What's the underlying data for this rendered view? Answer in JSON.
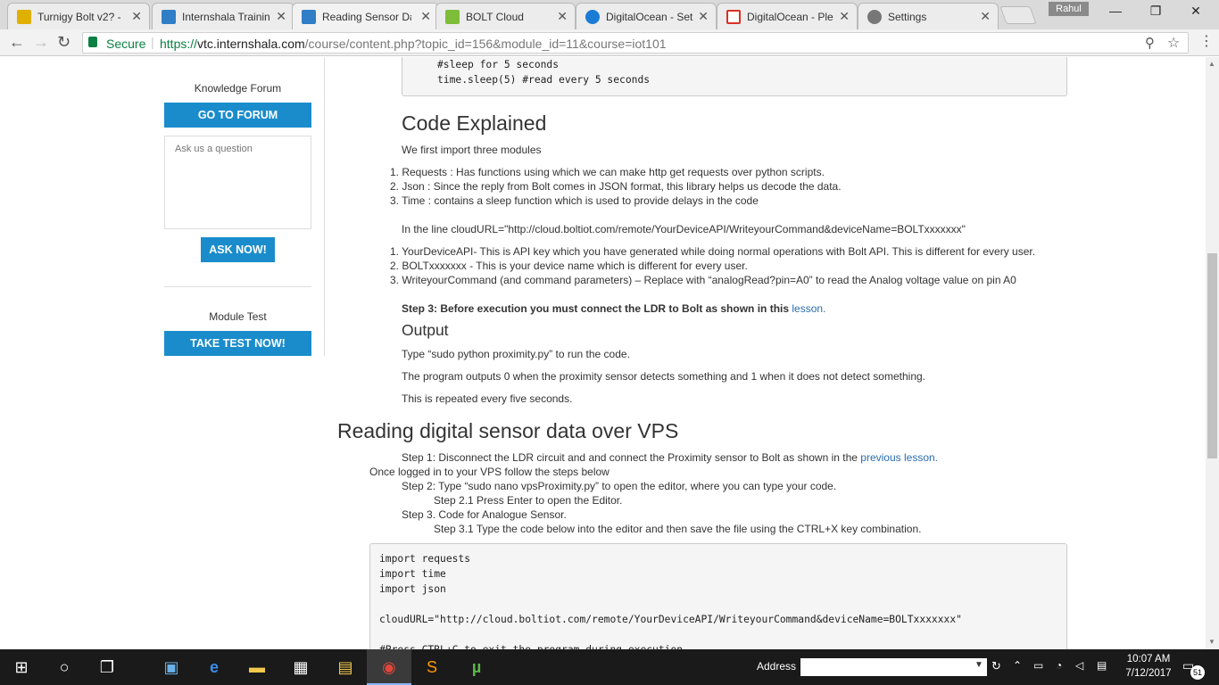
{
  "browser": {
    "tabs": [
      {
        "title": "Turnigy Bolt v2? -",
        "color": "#e0b000"
      },
      {
        "title": "Internshala Trainin",
        "color": "#2f7ec6"
      },
      {
        "title": "Reading Sensor Da",
        "color": "#2f7ec6"
      },
      {
        "title": "BOLT Cloud",
        "color": "#7dbd3a"
      },
      {
        "title": "DigitalOcean - Set",
        "color": "#1b7cd6"
      },
      {
        "title": "DigitalOcean - Ple",
        "color": "#d93025"
      },
      {
        "title": "Settings",
        "color": "#777777"
      }
    ],
    "user": "Rahul",
    "secure_label": "Secure",
    "url_prefix": "https://",
    "url_domain": "vtc.internshala.com",
    "url_path": "/course/content.php?topic_id=156&module_id=11&course=iot101"
  },
  "sidebar": {
    "forum_title": "Knowledge Forum",
    "forum_button": "GO TO FORUM",
    "question_placeholder": "Ask us a question",
    "ask_button": "ASK NOW!",
    "test_title": "Module Test",
    "test_button": "TAKE TEST NOW!"
  },
  "content": {
    "top_code": [
      "#sleep for 5 seconds",
      "time.sleep(5) #read every 5 seconds"
    ],
    "code_explained_title": "Code Explained",
    "intro": "We first import three modules",
    "modules": [
      "1. Requests : Has functions using which we can make http get requests over python scripts.",
      "2. Json : Since the reply from Bolt comes in JSON format, this library helps us decode the data.",
      "3. Time : contains a sleep function which is used to provide delays in the code"
    ],
    "cloudurl_line": "In the line cloudURL=\"http://cloud.boltiot.com/remote/YourDeviceAPI/WriteyourCommand&deviceName=BOLTxxxxxxx\"",
    "params": [
      "1. YourDeviceAPI- This is API key which you have generated while doing normal operations with Bolt API. This is different for every user.",
      "2. BOLTxxxxxxx - This is your device name which is different for every user.",
      "3. WriteyourCommand (and command parameters) – Replace with “analogRead?pin=A0” to read the Analog voltage value on pin A0"
    ],
    "step3": "Step 3: Before execution you must connect the LDR to Bolt as shown in this",
    "step3_link": "lesson.",
    "output_title": "Output",
    "output_lines": [
      "Type “sudo python proximity.py” to run the code.",
      "The program outputs 0 when the proximity sensor detects something and 1 when it does not detect something.",
      "This is repeated every five seconds."
    ],
    "section_title": "Reading digital sensor data over VPS",
    "step1": "Step 1: Disconnect the LDR circuit and and connect the Proximity sensor to Bolt as shown in the",
    "step1_link": "previous lesson.",
    "logged_in": "Once logged in to your VPS follow the steps below",
    "step2": "Step 2: Type “sudo nano vpsProximity.py” to open the editor, where you can type your code.",
    "step2_1": "Step 2.1 Press Enter to open the Editor.",
    "step3b": "Step 3. Code for Analogue Sensor.",
    "step3_1": "Step 3.1 Type the code below into the editor and then save the file using the CTRL+X key combination.",
    "code_lines": [
      "import requests",
      "import time",
      "import json",
      "",
      "cloudURL=\"http://cloud.boltiot.com/remote/YourDeviceAPI/WriteyourCommand&deviceName=BOLTxxxxxxx\"",
      "",
      "#Press CTRL+C to exit the program during execution"
    ]
  },
  "taskbar": {
    "address_label": "Address",
    "time": "10:07 AM",
    "date": "7/12/2017",
    "notifications": "51"
  }
}
